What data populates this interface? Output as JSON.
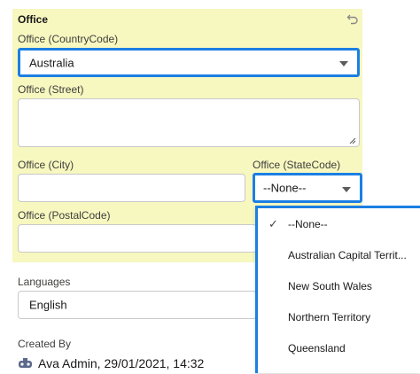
{
  "office": {
    "section_title": "Office",
    "country": {
      "label": "Office (CountryCode)",
      "value": "Australia"
    },
    "street": {
      "label": "Office (Street)",
      "value": ""
    },
    "city": {
      "label": "Office (City)",
      "value": ""
    },
    "state": {
      "label": "Office (StateCode)",
      "value": "--None--",
      "options": [
        "--None--",
        "Australian Capital Territ...",
        "New South Wales",
        "Northern Territory",
        "Queensland"
      ],
      "selected_index": 0
    },
    "postal": {
      "label": "Office (PostalCode)",
      "value": ""
    }
  },
  "languages": {
    "label": "Languages",
    "value": "English"
  },
  "created_by": {
    "label": "Created By",
    "user": "Ava Admin",
    "date": ", 29/01/2021, 14:32"
  },
  "icons": {
    "undo": "undo-icon",
    "caret": "chevron-down-icon",
    "check": "check-icon",
    "user": "user-avatar-icon"
  },
  "colors": {
    "panel_highlight": "#f7f7c0",
    "focus_border": "#1b7fe3"
  }
}
